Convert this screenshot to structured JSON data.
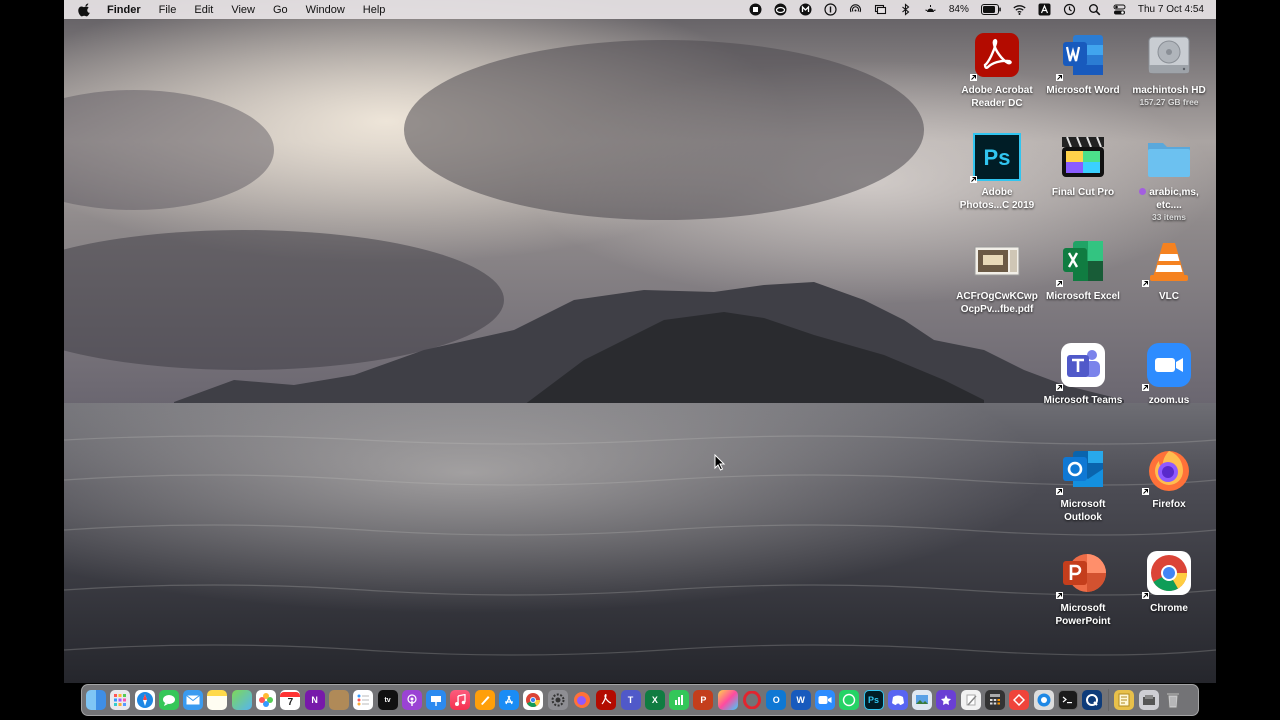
{
  "menubar": {
    "app_name": "Finder",
    "items": [
      "File",
      "Edit",
      "View",
      "Go",
      "Window",
      "Help"
    ],
    "battery": "84%",
    "datetime": "Thu 7 Oct  4:54"
  },
  "desktop_icons": [
    {
      "label": "Adobe Acrobat Reader DC",
      "icon": "acrobat-icon"
    },
    {
      "label": "Microsoft Word",
      "icon": "word-icon"
    },
    {
      "label": "machintosh HD",
      "sub": "157.27 GB free",
      "icon": "hard-drive-icon"
    },
    {
      "label": "Adobe Photos...C 2019",
      "icon": "photoshop-icon"
    },
    {
      "label": "Final Cut Pro",
      "icon": "final-cut-pro-icon"
    },
    {
      "label": "arabic,ms, etc....",
      "sub": "33 items",
      "icon": "folder-icon"
    },
    {
      "label": "ACFrOgCwKCwp OcpPv...fbe.pdf",
      "icon": "pdf-thumbnail-icon"
    },
    {
      "label": "Microsoft Excel",
      "icon": "excel-icon"
    },
    {
      "label": "VLC",
      "icon": "vlc-icon"
    },
    {
      "label": "Microsoft Teams",
      "icon": "teams-icon"
    },
    {
      "label": "zoom.us",
      "icon": "zoom-icon"
    },
    {
      "label": "Microsoft Outlook",
      "icon": "outlook-icon"
    },
    {
      "label": "Firefox",
      "icon": "firefox-icon"
    },
    {
      "label": "Microsoft PowerPoint",
      "icon": "powerpoint-icon"
    },
    {
      "label": "Chrome",
      "icon": "chrome-icon"
    }
  ],
  "dock": {
    "calendar_day": "7",
    "apps": [
      "finder",
      "launchpad",
      "safari",
      "messages",
      "mail",
      "notes",
      "maps",
      "photos",
      "calendar",
      "onenote",
      "contacts",
      "reminders",
      "apple-tv",
      "podcasts",
      "keynote",
      "music",
      "pages",
      "app-store",
      "chrome",
      "system-preferences",
      "firefox",
      "acrobat",
      "teams",
      "excel",
      "numbers",
      "powerpoint",
      "final-cut-pro",
      "opera",
      "outlook",
      "word",
      "zoom",
      "whatsapp",
      "photoshop",
      "discord",
      "preview",
      "imovie",
      "textedit",
      "calculator",
      "anydesk",
      "quicktime",
      "terminal",
      "quicktime-x"
    ],
    "right": [
      "notes-doc",
      "archive",
      "trash"
    ]
  }
}
